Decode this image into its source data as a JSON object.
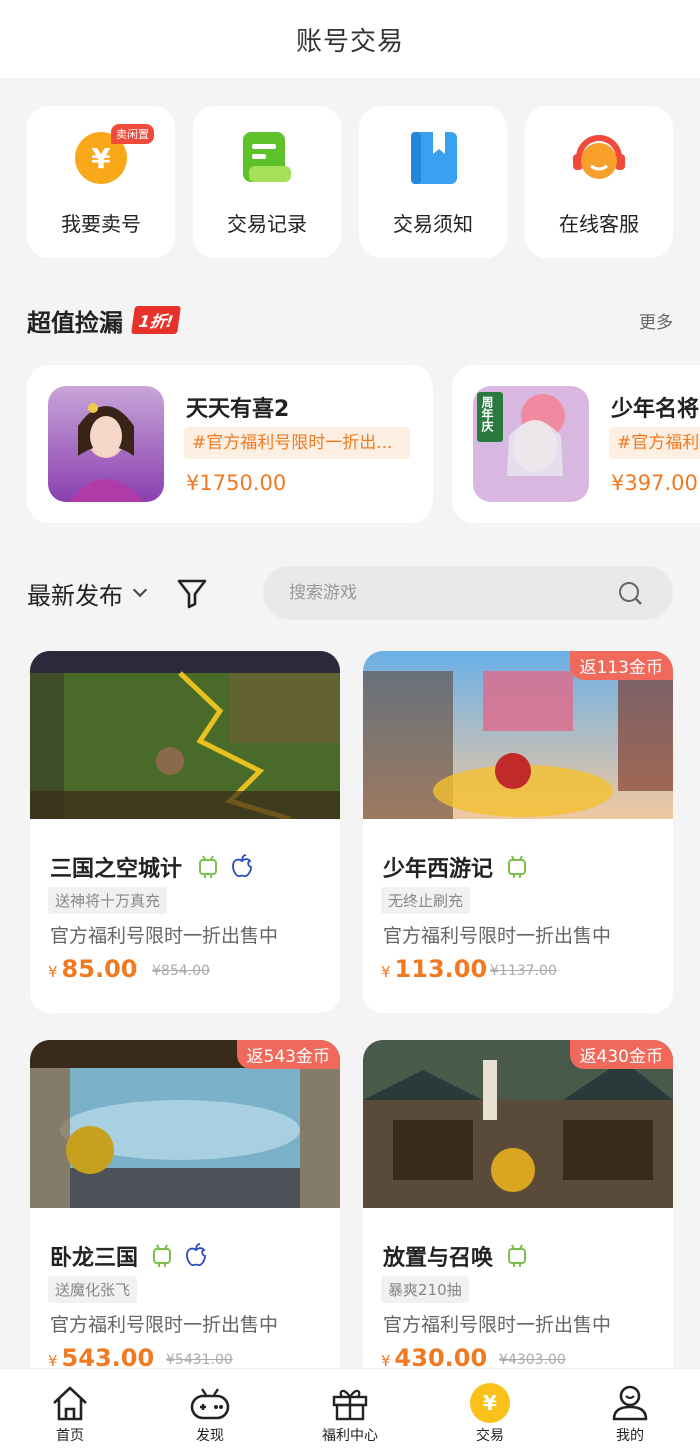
{
  "header": {
    "title": "账号交易"
  },
  "quick_actions": [
    {
      "label": "我要卖号",
      "icon": "yen-coin-icon",
      "badge": "卖闲置",
      "color": "#f9a81a"
    },
    {
      "label": "交易记录",
      "icon": "record-scroll-icon",
      "color": "#6fcf2f"
    },
    {
      "label": "交易须知",
      "icon": "bookmark-book-icon",
      "color": "#3aa0f0"
    },
    {
      "label": "在线客服",
      "icon": "headset-agent-icon",
      "color": "#f58a2a"
    }
  ],
  "deals": {
    "title": "超值捡漏",
    "badge": "1折!",
    "more": "更多",
    "items": [
      {
        "name": "天天有喜2",
        "tag": "#官方福利号限时一折出...",
        "price": "¥1750.00"
      },
      {
        "name": "少年名将",
        "tag": "#官方福利",
        "price": "¥397.00",
        "thumb_text": "周年庆"
      }
    ]
  },
  "filter": {
    "sort_label": "最新发布",
    "search_placeholder": "搜索游戏"
  },
  "listings": [
    {
      "name": "三国之空城计",
      "platforms": [
        "android",
        "ios"
      ],
      "tag": "送神将十万真充",
      "desc": "官方福利号限时一折出售中",
      "yen": "¥",
      "price": "85.00",
      "orig": "¥854.00",
      "rebate": ""
    },
    {
      "name": "少年西游记",
      "platforms": [
        "android"
      ],
      "tag": "无终止刷充",
      "desc": "官方福利号限时一折出售中",
      "yen": "¥",
      "price": "113.00",
      "orig": "¥1137.00",
      "rebate": "返113金币"
    },
    {
      "name": "卧龙三国",
      "platforms": [
        "android",
        "ios"
      ],
      "tag": "送魔化张飞",
      "desc": "官方福利号限时一折出售中",
      "yen": "¥",
      "price": "543.00",
      "orig": "¥5431.00",
      "rebate": "返543金币"
    },
    {
      "name": "放置与召唤",
      "platforms": [
        "android"
      ],
      "tag": "暴爽210抽",
      "desc": "官方福利号限时一折出售中",
      "yen": "¥",
      "price": "430.00",
      "orig": "¥4303.00",
      "rebate": "返430金币"
    }
  ],
  "tabbar": [
    {
      "label": "首页",
      "icon": "home-icon"
    },
    {
      "label": "发现",
      "icon": "gamepad-icon"
    },
    {
      "label": "福利中心",
      "icon": "gift-icon"
    },
    {
      "label": "交易",
      "icon": "yen-coin-icon",
      "active": true
    },
    {
      "label": "我的",
      "icon": "user-icon"
    }
  ],
  "colors": {
    "accent": "#f07a22",
    "rebate": "#f0695a",
    "active_tab": "#f9c11a"
  }
}
